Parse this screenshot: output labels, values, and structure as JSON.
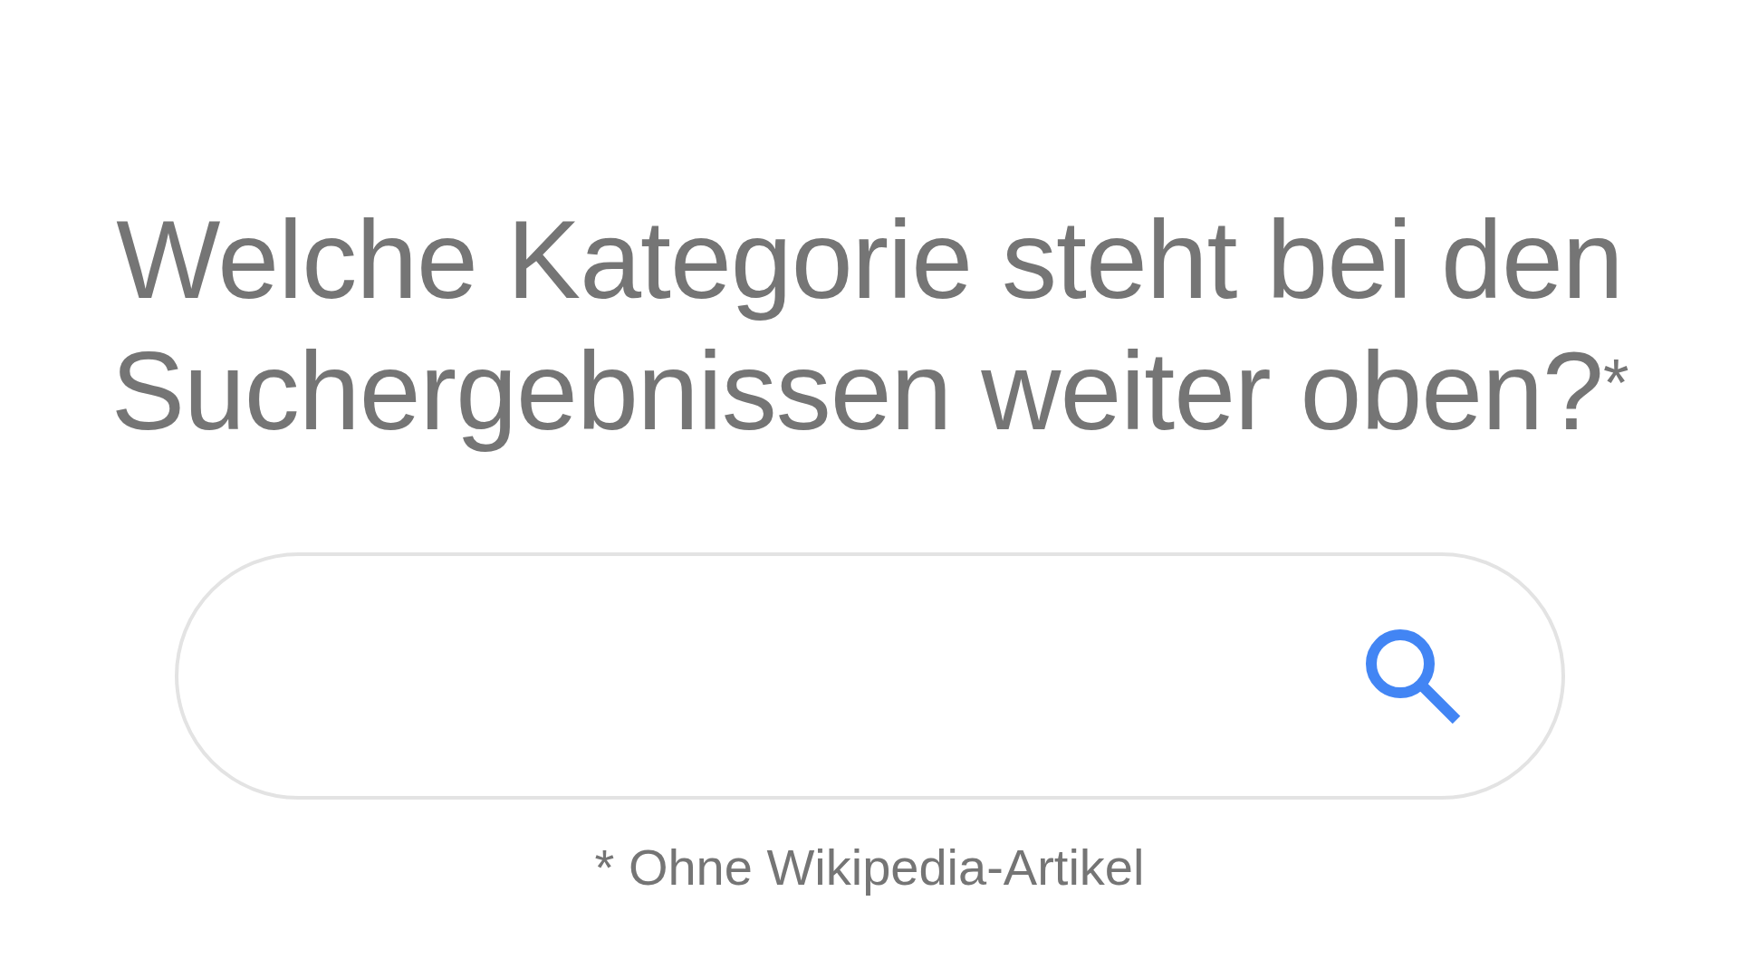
{
  "question": {
    "text": "Welche Kategorie steht bei den Suchergebnissen weiter oben?$^{*}$"
  },
  "footnote": {
    "text": "* Ohne Wikipedia-Artikel"
  }
}
